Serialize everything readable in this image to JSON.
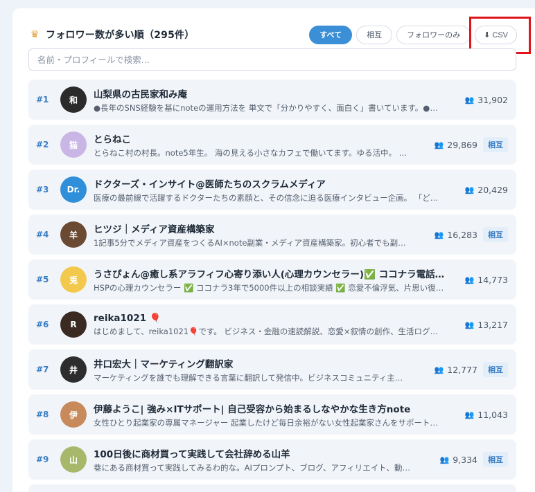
{
  "header": {
    "crown_icon": "crown-icon",
    "title": "フォロワー数が多い順（295件）"
  },
  "filters": {
    "all": "すべて",
    "mutual": "相互",
    "followers_only": "フォロワーのみ",
    "csv": "⬇ CSV"
  },
  "search": {
    "placeholder": "名前・プロフィールで検索..."
  },
  "colors": {
    "accent": "#3a8fd6",
    "rank": "#3a7dc2",
    "highlight_box": "#e0151c"
  },
  "rows": [
    {
      "rank": "#1",
      "name": "山梨県の古民家和み庵",
      "bio": "●長年のSNS経験を基にnoteの運用方法を 単文で「分かりやすく、面白く」書いています。●…",
      "followers": "31,902",
      "mutual": "",
      "avatar_color": "#2b2b2b",
      "avatar_text": "和"
    },
    {
      "rank": "#2",
      "name": "とらねこ",
      "bio": "とらねこ村の村長。note5年生。 海の見える小さなカフェで働いてます。ゆる活中。 …",
      "followers": "29,869",
      "mutual": "相互",
      "avatar_color": "#c9b6e4",
      "avatar_text": "猫"
    },
    {
      "rank": "#3",
      "name": "ドクターズ・インサイト@医師たちのスクラムメディア",
      "bio": "医療の最前線で活躍するドクターたちの素顔と、その信念に迫る医療インタビュー企画。 「ど…",
      "followers": "20,429",
      "mutual": "",
      "avatar_color": "#2f8fd8",
      "avatar_text": "Dr."
    },
    {
      "rank": "#4",
      "name": "ヒツジ｜メディア資産構築家",
      "bio": "1記事5分でメディア資産をつくるAI×note副業・メディア資産構築家。初心者でも副…",
      "followers": "16,283",
      "mutual": "相互",
      "avatar_color": "#6b4a33",
      "avatar_text": "羊"
    },
    {
      "rank": "#5",
      "name": "うさぴょん@癒し系アラフィフ心寄り添い人(心理カウンセラー)✅ ココナラ電話…",
      "bio": "HSPの心理カウンセラー ✅ ココナラ3年で5000件以上の相談実績 ✅ 恋愛不倫浮気、片思い復…",
      "followers": "14,773",
      "mutual": "",
      "avatar_color": "#f2c94c",
      "avatar_text": "兎"
    },
    {
      "rank": "#6",
      "name": "reika1021 🎈",
      "bio": "はじめまして、reika1021🎈です。 ビジネス・金融の速読解説、恋愛×叙情の創作、生活ログ…",
      "followers": "13,217",
      "mutual": "",
      "avatar_color": "#3a2a22",
      "avatar_text": "R"
    },
    {
      "rank": "#7",
      "name": "井口宏大｜マーケティング翻訳家",
      "bio": "マーケティングを誰でも理解できる言葉に翻訳して発信中。ビジネスコミュニティ主…",
      "followers": "12,777",
      "mutual": "相互",
      "avatar_color": "#2d2d2d",
      "avatar_text": "井"
    },
    {
      "rank": "#8",
      "name": "伊藤ようこ| 強み×ITサポート| 自己受容から始まるしなやかな生き方note",
      "bio": "女性ひとり起業家の専属マネージャー 起業したけど毎日余裕がない女性起業家さんをサポート…",
      "followers": "11,043",
      "mutual": "",
      "avatar_color": "#c88a5a",
      "avatar_text": "伊"
    },
    {
      "rank": "#9",
      "name": "100日後に商材買って実践して会社辞める山羊",
      "bio": "巷にある商材買って実践してみるわ的な。AIプロンプト、ブログ、アフィリエイト、動…",
      "followers": "9,334",
      "mutual": "相互",
      "avatar_color": "#a8b86a",
      "avatar_text": "山"
    }
  ]
}
